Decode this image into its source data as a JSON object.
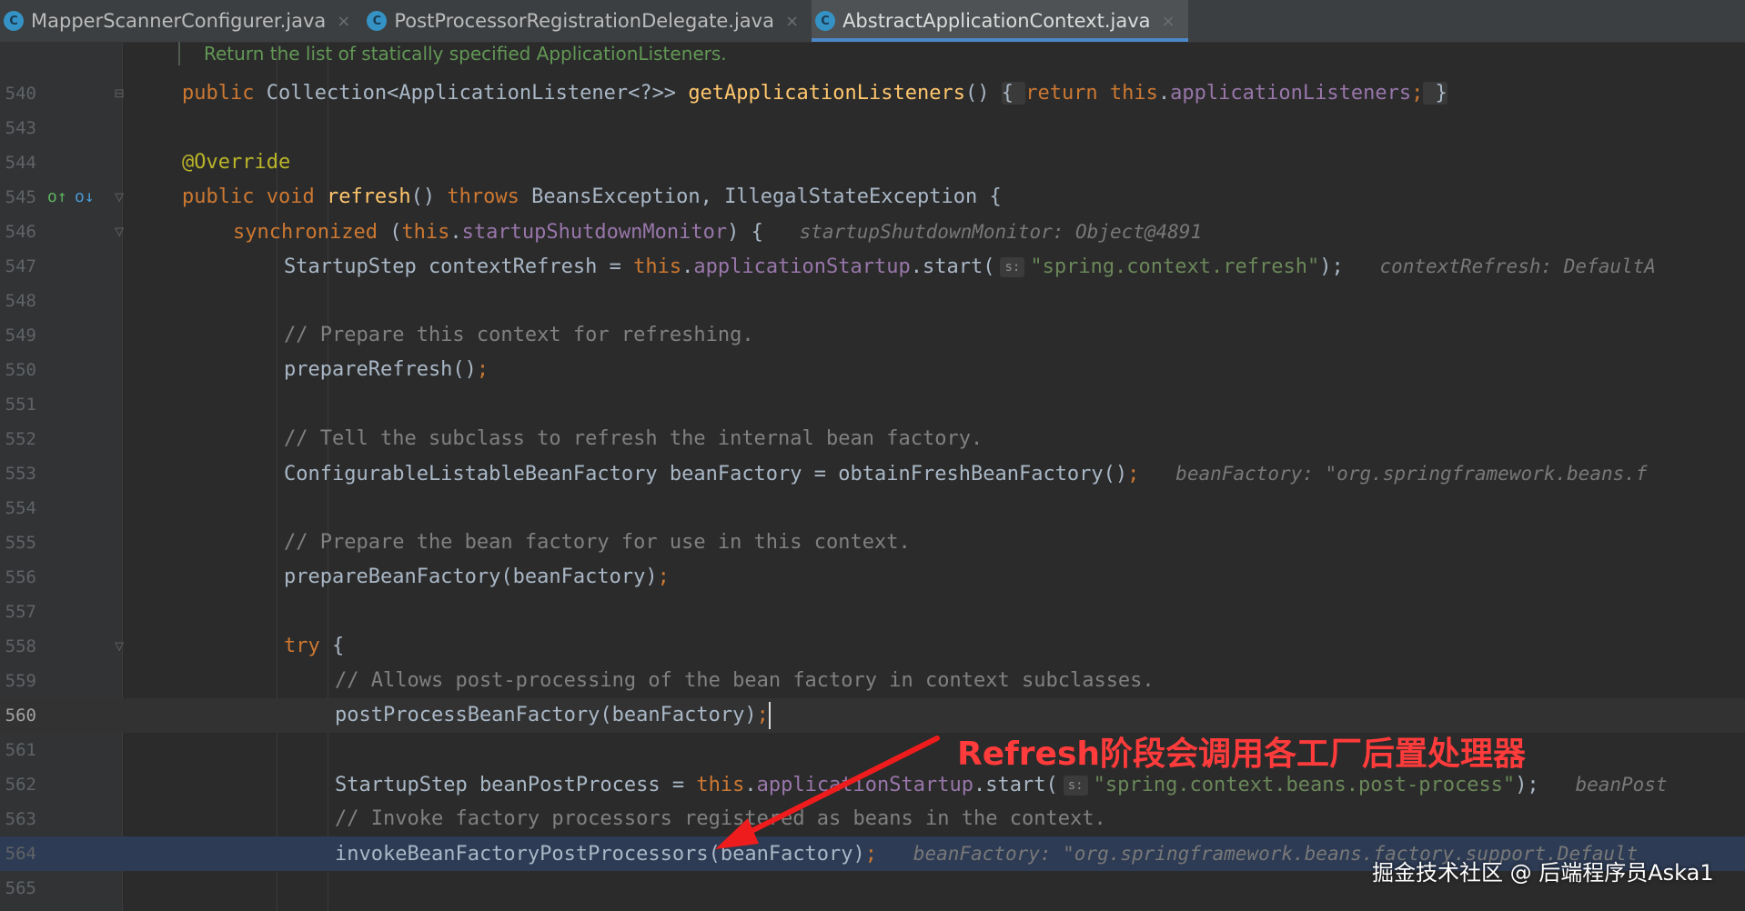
{
  "tabs": [
    {
      "label": "MapperScannerConfigurer.java",
      "active": false
    },
    {
      "label": "PostProcessorRegistrationDelegate.java",
      "active": false
    },
    {
      "label": "AbstractApplicationContext.java",
      "active": true
    }
  ],
  "doc_comment": "Return the list of statically specified ApplicationListeners.",
  "lines": {
    "540": {
      "num": "540",
      "p1": "public ",
      "p2": "Collection<ApplicationListener<?>> ",
      "p3": "getApplicationListeners",
      "p4": "() ",
      "p5": "{ ",
      "p6": "return ",
      "p7": "this",
      "p8": ".",
      "p9": "applicationListeners",
      "p10": ";",
      "p11": " }"
    },
    "543": {
      "num": "543"
    },
    "544": {
      "num": "544",
      "p1": "@Override"
    },
    "545": {
      "num": "545",
      "p1": "public ",
      "p2": "void ",
      "p3": "refresh",
      "p4": "() ",
      "p5": "throws ",
      "p6": "BeansException, IllegalStateException {"
    },
    "546": {
      "num": "546",
      "p1": "synchronized ",
      "p2": "(",
      "p3": "this",
      "p4": ".",
      "p5": "startupShutdownMonitor",
      "p6": ") {",
      "hint": "startupShutdownMonitor: Object@4891"
    },
    "547": {
      "num": "547",
      "p1": "StartupStep contextRefresh = ",
      "p2": "this",
      "p3": ".",
      "p4": "applicationStartup",
      "p5": ".start(",
      "ph": "s:",
      "p6": "\"spring.context.refresh\"",
      "p7": ");",
      "hint": "contextRefresh: DefaultA"
    },
    "548": {
      "num": "548"
    },
    "549": {
      "num": "549",
      "p1": "// Prepare this context for refreshing."
    },
    "550": {
      "num": "550",
      "p1": "prepareRefresh()",
      "p2": ";"
    },
    "551": {
      "num": "551"
    },
    "552": {
      "num": "552",
      "p1": "// Tell the subclass to refresh the internal bean factory."
    },
    "553": {
      "num": "553",
      "p1": "ConfigurableListableBeanFactory beanFactory = obtainFreshBeanFactory()",
      "p2": ";",
      "hint": "beanFactory: \"org.springframework.beans.f"
    },
    "554": {
      "num": "554"
    },
    "555": {
      "num": "555",
      "p1": "// Prepare the bean factory for use in this context."
    },
    "556": {
      "num": "556",
      "p1": "prepareBeanFactory(beanFactory)",
      "p2": ";"
    },
    "557": {
      "num": "557"
    },
    "558": {
      "num": "558",
      "p1": "try ",
      "p2": "{"
    },
    "559": {
      "num": "559",
      "p1": "// Allows post-processing of the bean factory in context subclasses."
    },
    "560": {
      "num": "560",
      "p1": "postProcessBeanFactory(beanFactory)",
      "p2": ";"
    },
    "561": {
      "num": "561"
    },
    "562": {
      "num": "562",
      "p1": "StartupStep beanPostProcess = ",
      "p2": "this",
      "p3": ".",
      "p4": "applicationStartup",
      "p5": ".start(",
      "ph": "s:",
      "p6": "\"spring.context.beans.post-process\"",
      "p7": ");",
      "hint": "beanPost"
    },
    "563": {
      "num": "563",
      "p1": "// Invoke factory processors registered as beans in the context."
    },
    "564": {
      "num": "564",
      "p1": "invokeBeanFactoryPostProcessors(beanFactory)",
      "p2": ";",
      "hint": "beanFactory: \"org.springframework.beans.factory.support.Default"
    },
    "565": {
      "num": "565"
    }
  },
  "annotation": "Refresh阶段会调用各工厂后置处理器",
  "watermark": "掘金技术社区 @ 后端程序员Aska1",
  "colors": {
    "background": "#2b2b2b",
    "keyword": "#cc7832",
    "method": "#ffc66d",
    "field": "#9876aa",
    "string": "#6a8759",
    "comment": "#808080",
    "annotation_red": "#ff3b3b",
    "active_tab_underline": "#4a88c7"
  },
  "icons": {
    "tab_file_icon": "java-class-icon",
    "gutter_545_a": "override-up-arrow-icon",
    "gutter_545_b": "implemented-down-arrow-icon"
  }
}
